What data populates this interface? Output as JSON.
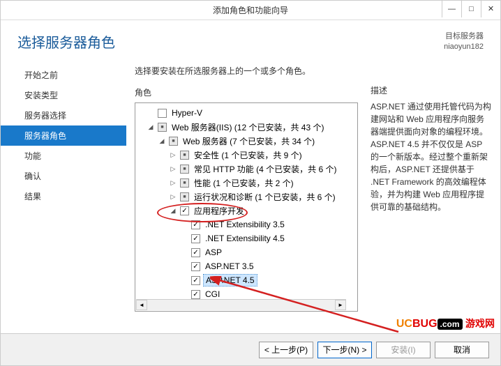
{
  "window": {
    "title": "添加角色和功能向导"
  },
  "page": {
    "title": "选择服务器角色"
  },
  "dest": {
    "label": "目标服务器",
    "name": "niaoyun182"
  },
  "sidebar": {
    "items": [
      {
        "label": "开始之前"
      },
      {
        "label": "安装类型"
      },
      {
        "label": "服务器选择"
      },
      {
        "label": "服务器角色"
      },
      {
        "label": "功能"
      },
      {
        "label": "确认"
      },
      {
        "label": "结果"
      }
    ],
    "active_index": 3
  },
  "content": {
    "intro": "选择要安装在所选服务器上的一个或多个角色。",
    "roles_header": "角色",
    "desc_header": "描述",
    "desc_text": "ASP.NET 通过使用托管代码为构建网站和 Web 应用程序向服务器端提供面向对象的编程环境。ASP.NET 4.5 并不仅仅是 ASP 的一个新版本。经过整个重新架构后，ASP.NET 还提供基于 .NET Framework 的高效编程体验，并为构建 Web 应用程序提供可靠的基础结构。"
  },
  "tree": [
    {
      "indent": 1,
      "exp": "",
      "cb": "empty",
      "label": "Hyper-V"
    },
    {
      "indent": 1,
      "exp": "◢",
      "cb": "partial",
      "label": "Web 服务器(IIS) (12 个已安装，共 43 个)"
    },
    {
      "indent": 2,
      "exp": "◢",
      "cb": "partial",
      "label": "Web 服务器 (7 个已安装，共 34 个)"
    },
    {
      "indent": 3,
      "exp": "▷",
      "cb": "partial",
      "label": "安全性 (1 个已安装，共 9 个)"
    },
    {
      "indent": 3,
      "exp": "▷",
      "cb": "partial",
      "label": "常见 HTTP 功能 (4 个已安装，共 6 个)"
    },
    {
      "indent": 3,
      "exp": "▷",
      "cb": "partial",
      "label": "性能 (1 个已安装，共 2 个)"
    },
    {
      "indent": 3,
      "exp": "▷",
      "cb": "partial",
      "label": "运行状况和诊断 (1 个已安装，共 6 个)"
    },
    {
      "indent": 3,
      "exp": "◢",
      "cb": "checked",
      "label": "应用程序开发"
    },
    {
      "indent": 4,
      "exp": "",
      "cb": "checked",
      "label": ".NET Extensibility 3.5"
    },
    {
      "indent": 4,
      "exp": "",
      "cb": "checked",
      "label": ".NET Extensibility 4.5"
    },
    {
      "indent": 4,
      "exp": "",
      "cb": "checked",
      "label": "ASP"
    },
    {
      "indent": 4,
      "exp": "",
      "cb": "checked",
      "label": "ASP.NET 3.5"
    },
    {
      "indent": 4,
      "exp": "",
      "cb": "checked",
      "label": "ASP.NET 4.5",
      "selected": true
    },
    {
      "indent": 4,
      "exp": "",
      "cb": "checked",
      "label": "CGI"
    }
  ],
  "buttons": {
    "prev": "< 上一步(P)",
    "next": "下一步(N) >",
    "install": "安装(I)",
    "cancel": "取消"
  },
  "watermark": {
    "brand1": "UC",
    "brand2": "BUG",
    "url": ".com",
    "cn": "游戏网"
  }
}
